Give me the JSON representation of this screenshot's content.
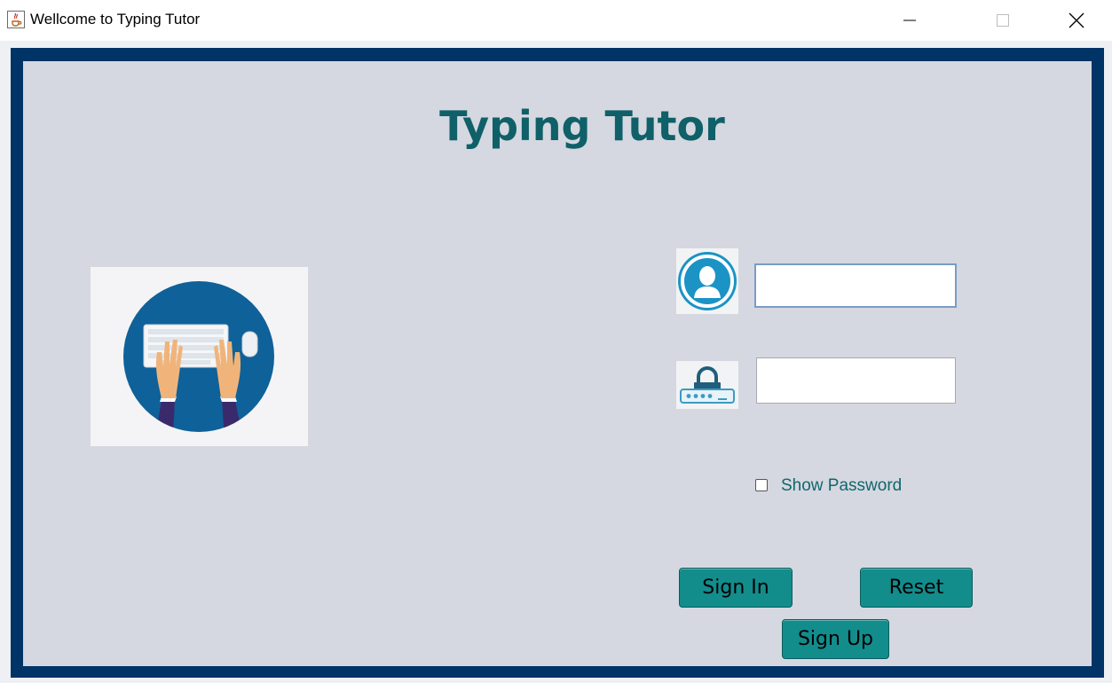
{
  "window": {
    "title": "Wellcome to Typing Tutor",
    "icons": {
      "app": "java-app-icon",
      "minimize": "minimize-icon",
      "maximize": "maximize-icon",
      "close": "close-icon"
    }
  },
  "main": {
    "heading": "Typing Tutor",
    "illustration_icon": "hands-typing-keyboard-illustration",
    "username": {
      "value": "",
      "icon": "user-icon"
    },
    "password": {
      "value": "",
      "icon": "lock-password-icon"
    },
    "show_password": {
      "label": "Show Password",
      "checked": false
    },
    "buttons": {
      "sign_in": "Sign In",
      "reset": "Reset",
      "sign_up": "Sign Up"
    }
  },
  "colors": {
    "outer_border": "#003366",
    "panel_bg": "#d5d8e0",
    "heading": "#0f6068",
    "button": "#138c8c",
    "checkbox_label": "#11666e"
  }
}
